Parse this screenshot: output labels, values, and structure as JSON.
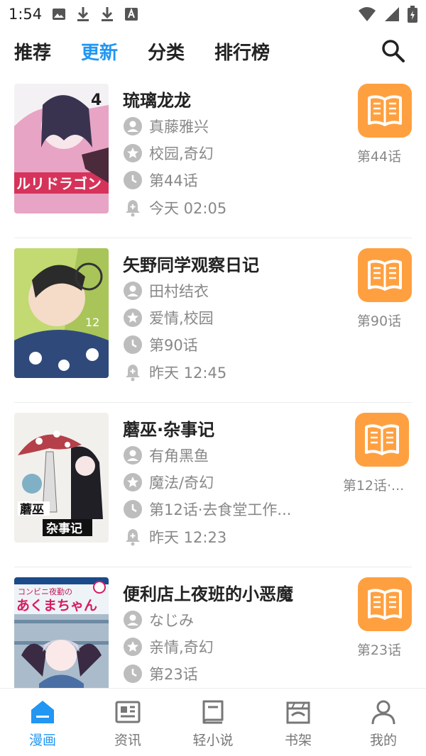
{
  "status": {
    "time": "1:54"
  },
  "tabs": [
    {
      "label": "推荐"
    },
    {
      "label": "更新"
    },
    {
      "label": "分类"
    },
    {
      "label": "排行榜"
    }
  ],
  "colors": {
    "accent": "#2196f3",
    "read_button": "#ffa040",
    "meta_text": "#888888"
  },
  "items": [
    {
      "title": "琉璃龙龙",
      "author": "真藤雅兴",
      "tags": "校园,奇幻",
      "chapter": "第44话",
      "updated": "今天 02:05",
      "latest": "第44话"
    },
    {
      "title": "矢野同学观察日记",
      "author": "田村结衣",
      "tags": "爱情,校园",
      "chapter": "第90话",
      "updated": "昨天 12:45",
      "latest": "第90话"
    },
    {
      "title": "蘑巫·杂事记",
      "author": "有角黑鱼",
      "tags": "魔法/奇幻",
      "chapter": "第12话·去食堂工作...",
      "updated": "昨天 12:23",
      "latest": "第12话·..."
    },
    {
      "title": "便利店上夜班的小恶魔",
      "author": "なじみ",
      "tags": "亲情,奇幻",
      "chapter": "第23话",
      "updated": "",
      "latest": "第23话"
    }
  ],
  "bottom_nav": [
    {
      "label": "漫画",
      "icon": "home-icon"
    },
    {
      "label": "资讯",
      "icon": "news-icon"
    },
    {
      "label": "轻小说",
      "icon": "book-icon"
    },
    {
      "label": "书架",
      "icon": "shelf-icon"
    },
    {
      "label": "我的",
      "icon": "user-icon"
    }
  ]
}
